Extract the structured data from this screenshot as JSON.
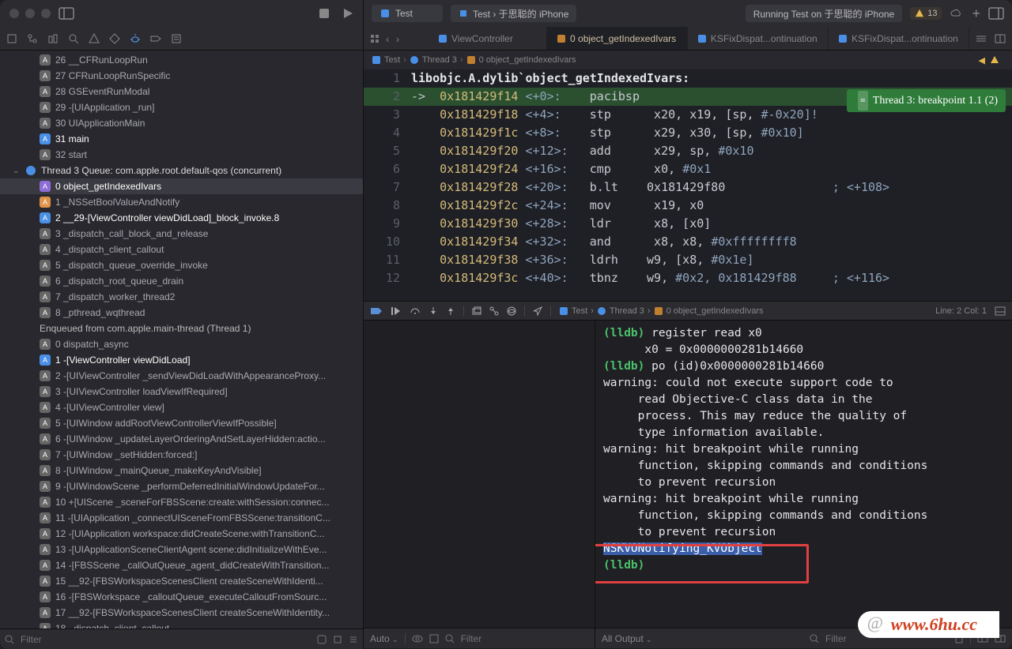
{
  "left_titlebar": {
    "stop_label": "Stop",
    "run_label": "Run"
  },
  "right_titlebar": {
    "scheme": "Test",
    "device": "Test › 于思聪的 iPhone",
    "status": "Running Test on 于思聪的 iPhone",
    "warn_count": "13"
  },
  "tabs": [
    {
      "label": "ViewController"
    },
    {
      "label": "0 object_getIndexedIvars"
    },
    {
      "label": "KSFixDispat...ontinuation"
    },
    {
      "label": "KSFixDispat...ontinuation"
    }
  ],
  "breadcrumb": [
    "Test",
    "Thread 3",
    "0 object_getIndexedIvars"
  ],
  "debug_toolbar": {
    "crumbs": [
      "Test",
      "Thread 3",
      "0 object_getIndexedIvars"
    ],
    "position": "Line: 2  Col: 1"
  },
  "breakpoint_banner": "Thread 3: breakpoint 1.1 (2)",
  "sidebar": {
    "items_top": [
      {
        "n": "26",
        "t": "__CFRunLoopRun",
        "cls": "gray"
      },
      {
        "n": "27",
        "t": "CFRunLoopRunSpecific",
        "cls": "gray"
      },
      {
        "n": "28",
        "t": "GSEventRunModal",
        "cls": "gray"
      },
      {
        "n": "29",
        "t": "-[UIApplication _run]",
        "cls": "gray"
      },
      {
        "n": "30",
        "t": "UIApplicationMain",
        "cls": "gray"
      },
      {
        "n": "31",
        "t": "main",
        "bold": true,
        "cls": "blue"
      },
      {
        "n": "32",
        "t": "start",
        "cls": "gray"
      }
    ],
    "thread3_header": "Thread 3  Queue: com.apple.root.default-qos (concurrent)",
    "thread3": [
      {
        "n": "0",
        "t": "object_getIndexedIvars",
        "sel": true,
        "bold": true,
        "cls": "purple"
      },
      {
        "n": "1",
        "t": "_NSSetBoolValueAndNotify",
        "cls": "orange"
      },
      {
        "n": "2",
        "t": "__29-[ViewController viewDidLoad]_block_invoke.8",
        "bold": true,
        "cls": "blue"
      },
      {
        "n": "3",
        "t": "_dispatch_call_block_and_release",
        "cls": "gray"
      },
      {
        "n": "4",
        "t": "_dispatch_client_callout",
        "cls": "gray"
      },
      {
        "n": "5",
        "t": "_dispatch_queue_override_invoke",
        "cls": "gray"
      },
      {
        "n": "6",
        "t": "_dispatch_root_queue_drain",
        "cls": "gray"
      },
      {
        "n": "7",
        "t": "_dispatch_worker_thread2",
        "cls": "gray"
      },
      {
        "n": "8",
        "t": "_pthread_wqthread",
        "cls": "gray"
      }
    ],
    "enqueued_header": "Enqueued from com.apple.main-thread (Thread 1)",
    "enqueued": [
      {
        "n": "0",
        "t": "dispatch_async",
        "cls": "gray"
      },
      {
        "n": "1",
        "t": "-[ViewController viewDidLoad]",
        "bold": true,
        "cls": "blue"
      },
      {
        "n": "2",
        "t": "-[UIViewController _sendViewDidLoadWithAppearanceProxy...",
        "cls": "gray"
      },
      {
        "n": "3",
        "t": "-[UIViewController loadViewIfRequired]",
        "cls": "gray"
      },
      {
        "n": "4",
        "t": "-[UIViewController view]",
        "cls": "gray"
      },
      {
        "n": "5",
        "t": "-[UIWindow addRootViewControllerViewIfPossible]",
        "cls": "gray"
      },
      {
        "n": "6",
        "t": "-[UIWindow _updateLayerOrderingAndSetLayerHidden:actio...",
        "cls": "gray"
      },
      {
        "n": "7",
        "t": "-[UIWindow _setHidden:forced:]",
        "cls": "gray"
      },
      {
        "n": "8",
        "t": "-[UIWindow _mainQueue_makeKeyAndVisible]",
        "cls": "gray"
      },
      {
        "n": "9",
        "t": "-[UIWindowScene _performDeferredInitialWindowUpdateFor...",
        "cls": "gray"
      },
      {
        "n": "10",
        "t": "+[UIScene _sceneForFBSScene:create:withSession:connec...",
        "cls": "gray"
      },
      {
        "n": "11",
        "t": "-[UIApplication _connectUISceneFromFBSScene:transitionC...",
        "cls": "gray"
      },
      {
        "n": "12",
        "t": "-[UIApplication workspace:didCreateScene:withTransitionC...",
        "cls": "gray"
      },
      {
        "n": "13",
        "t": "-[UIApplicationSceneClientAgent scene:didInitializeWithEve...",
        "cls": "gray"
      },
      {
        "n": "14",
        "t": "-[FBSScene _callOutQueue_agent_didCreateWithTransition...",
        "cls": "gray"
      },
      {
        "n": "15",
        "t": "__92-[FBSWorkspaceScenesClient createSceneWithIdenti...",
        "cls": "gray"
      },
      {
        "n": "16",
        "t": "-[FBSWorkspace _calloutQueue_executeCalloutFromSourc...",
        "cls": "gray"
      },
      {
        "n": "17",
        "t": "__92-[FBSWorkspaceScenesClient createSceneWithIdentity...",
        "cls": "gray"
      },
      {
        "n": "18",
        "t": "_dispatch_client_callout",
        "cls": "gray"
      }
    ]
  },
  "filter": {
    "placeholder_left": "Filter",
    "placeholder_mid": "Filter",
    "placeholder_right": "Filter"
  },
  "disasm": {
    "title": "libobjc.A.dylib`object_getIndexedIvars:",
    "lines": [
      {
        "ln": 1,
        "title": true
      },
      {
        "ln": 2,
        "cur": true,
        "addr": "0x181429f14",
        "off": "<+0>:",
        "mnem": "pacibsp",
        "rest": ""
      },
      {
        "ln": 3,
        "addr": "0x181429f18",
        "off": "<+4>:",
        "mnem": "stp",
        "rest": "   x20, x19, [sp, ",
        "tail": "#-0x20]!"
      },
      {
        "ln": 4,
        "addr": "0x181429f1c",
        "off": "<+8>:",
        "mnem": "stp",
        "rest": "   x29, x30, [sp, ",
        "tail": "#0x10]"
      },
      {
        "ln": 5,
        "addr": "0x181429f20",
        "off": "<+12>:",
        "mnem": "add",
        "rest": "   x29, sp, ",
        "tail": "#0x10"
      },
      {
        "ln": 6,
        "addr": "0x181429f24",
        "off": "<+16>:",
        "mnem": "cmp",
        "rest": "   x0, ",
        "tail": "#0x1"
      },
      {
        "ln": 7,
        "addr": "0x181429f28",
        "off": "<+20>:",
        "mnem": "b.lt",
        "rest": "  0x181429f80",
        "cmt": "               ; <+108>"
      },
      {
        "ln": 8,
        "addr": "0x181429f2c",
        "off": "<+24>:",
        "mnem": "mov",
        "rest": "   x19, x0"
      },
      {
        "ln": 9,
        "addr": "0x181429f30",
        "off": "<+28>:",
        "mnem": "ldr",
        "rest": "   x8, [x0]"
      },
      {
        "ln": 10,
        "addr": "0x181429f34",
        "off": "<+32>:",
        "mnem": "and",
        "rest": "   x8, x8, ",
        "tail": "#0xffffffff8"
      },
      {
        "ln": 11,
        "addr": "0x181429f38",
        "off": "<+36>:",
        "mnem": "ldrh",
        "rest": "  w9, [x8, ",
        "tail": "#0x1e]"
      },
      {
        "ln": 12,
        "addr": "0x181429f3c",
        "off": "<+40>:",
        "mnem": "tbnz",
        "rest": "  w9, ",
        "tail": "#0x2, 0x181429f88",
        "cmt": "     ; <+116>"
      }
    ]
  },
  "console": [
    {
      "pre": "(lldb) ",
      "body": "register read x0",
      "green": true
    },
    {
      "pre": "",
      "body": "      x0 = 0x0000000281b14660"
    },
    {
      "pre": "(lldb) ",
      "body": "po (id)0x0000000281b14660",
      "green": true
    },
    {
      "pre": "",
      "body": "warning: could not execute support code to"
    },
    {
      "pre": "",
      "body": "     read Objective-C class data in the"
    },
    {
      "pre": "",
      "body": "     process. This may reduce the quality of"
    },
    {
      "pre": "",
      "body": "     type information available."
    },
    {
      "pre": "",
      "body": ""
    },
    {
      "pre": "",
      "body": "warning: hit breakpoint while running"
    },
    {
      "pre": "",
      "body": "     function, skipping commands and conditions"
    },
    {
      "pre": "",
      "body": "     to prevent recursion"
    },
    {
      "pre": "",
      "body": "warning: hit breakpoint while running"
    },
    {
      "pre": "",
      "body": "     function, skipping commands and conditions"
    },
    {
      "pre": "",
      "body": "     to prevent recursion"
    },
    {
      "pre": "",
      "body": "NSKVONotifying_KVObject",
      "sel": true
    },
    {
      "pre": "",
      "body": ""
    },
    {
      "pre": "(lldb) ",
      "body": "",
      "green": true
    }
  ],
  "dbg_bot": {
    "auto": "Auto",
    "all_output": "All Output"
  },
  "watermark": "www.6hu.cc"
}
